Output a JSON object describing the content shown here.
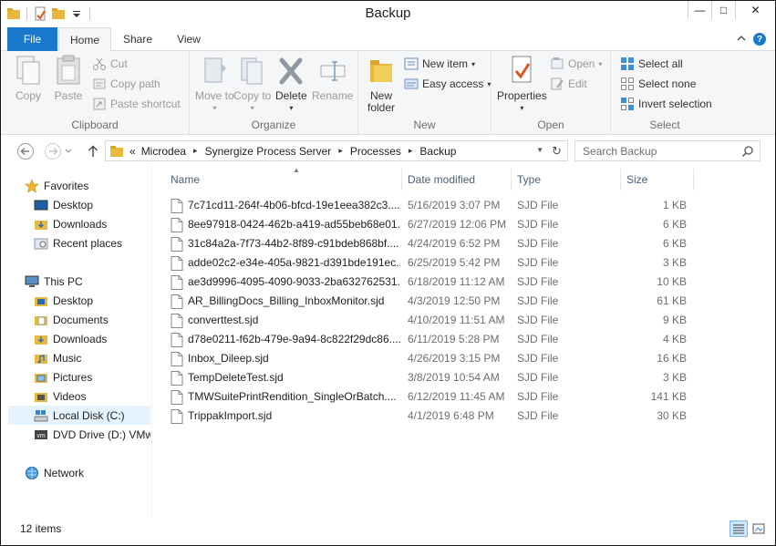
{
  "window": {
    "title": "Backup",
    "controls": {
      "minimize": "—",
      "maximize": "□",
      "close": "✕"
    }
  },
  "ribbon": {
    "tabs": [
      "File",
      "Home",
      "Share",
      "View"
    ],
    "active_tab": "Home",
    "clipboard": {
      "label": "Clipboard",
      "copy": "Copy",
      "paste": "Paste",
      "cut": "Cut",
      "copy_path": "Copy path",
      "paste_shortcut": "Paste shortcut"
    },
    "organize": {
      "label": "Organize",
      "move_to": "Move to",
      "copy_to": "Copy to",
      "delete": "Delete",
      "rename": "Rename"
    },
    "new": {
      "label": "New",
      "new_folder": "New folder",
      "new_item": "New item",
      "easy_access": "Easy access"
    },
    "open": {
      "label": "Open",
      "properties": "Properties",
      "open": "Open",
      "edit": "Edit"
    },
    "select": {
      "label": "Select",
      "select_all": "Select all",
      "select_none": "Select none",
      "invert_selection": "Invert selection"
    }
  },
  "address": {
    "prefix": "«",
    "crumbs": [
      "Microdea",
      "Synergize Process Server",
      "Processes",
      "Backup"
    ],
    "search_placeholder": "Search Backup"
  },
  "nav": {
    "favorites_label": "Favorites",
    "favorites": [
      "Desktop",
      "Downloads",
      "Recent places"
    ],
    "this_pc_label": "This PC",
    "this_pc": [
      "Desktop",
      "Documents",
      "Downloads",
      "Music",
      "Pictures",
      "Videos",
      "Local Disk (C:)",
      "DVD Drive (D:) VMware Tools"
    ],
    "selected": "Local Disk (C:)",
    "network_label": "Network"
  },
  "columns": {
    "name": "Name",
    "date": "Date modified",
    "type": "Type",
    "size": "Size"
  },
  "files": [
    {
      "name": "7c71cd11-264f-4b06-bfcd-19e1eea382c3....",
      "date": "5/16/2019 3:07 PM",
      "type": "SJD File",
      "size": "1 KB"
    },
    {
      "name": "8ee97918-0424-462b-a419-ad55beb68e01...",
      "date": "6/27/2019 12:06 PM",
      "type": "SJD File",
      "size": "6 KB"
    },
    {
      "name": "31c84a2a-7f73-44b2-8f89-c91bdeb868bf....",
      "date": "4/24/2019 6:52 PM",
      "type": "SJD File",
      "size": "6 KB"
    },
    {
      "name": "adde02c2-e34e-405a-9821-d391bde191ec...",
      "date": "6/25/2019 5:42 PM",
      "type": "SJD File",
      "size": "3 KB"
    },
    {
      "name": "ae3d9996-4095-4090-9033-2ba632762531....",
      "date": "6/18/2019 11:12 AM",
      "type": "SJD File",
      "size": "10 KB"
    },
    {
      "name": "AR_BillingDocs_Billing_InboxMonitor.sjd",
      "date": "4/3/2019 12:50 PM",
      "type": "SJD File",
      "size": "61 KB"
    },
    {
      "name": "converttest.sjd",
      "date": "4/10/2019 11:51 AM",
      "type": "SJD File",
      "size": "9 KB"
    },
    {
      "name": "d78e0211-f62b-479e-9a94-8c822f29dc86....",
      "date": "6/11/2019 5:28 PM",
      "type": "SJD File",
      "size": "4 KB"
    },
    {
      "name": "Inbox_Dileep.sjd",
      "date": "4/26/2019 3:15 PM",
      "type": "SJD File",
      "size": "16 KB"
    },
    {
      "name": "TempDeleteTest.sjd",
      "date": "3/8/2019 10:54 AM",
      "type": "SJD File",
      "size": "3 KB"
    },
    {
      "name": "TMWSuitePrintRendition_SingleOrBatch....",
      "date": "6/12/2019 11:45 AM",
      "type": "SJD File",
      "size": "141 KB"
    },
    {
      "name": "TrippakImport.sjd",
      "date": "4/1/2019 6:48 PM",
      "type": "SJD File",
      "size": "30 KB"
    }
  ],
  "status": {
    "count": "12 items"
  },
  "colors": {
    "accent": "#1979ca",
    "selection": "#e5f3ff",
    "header_text": "#4c607a"
  }
}
